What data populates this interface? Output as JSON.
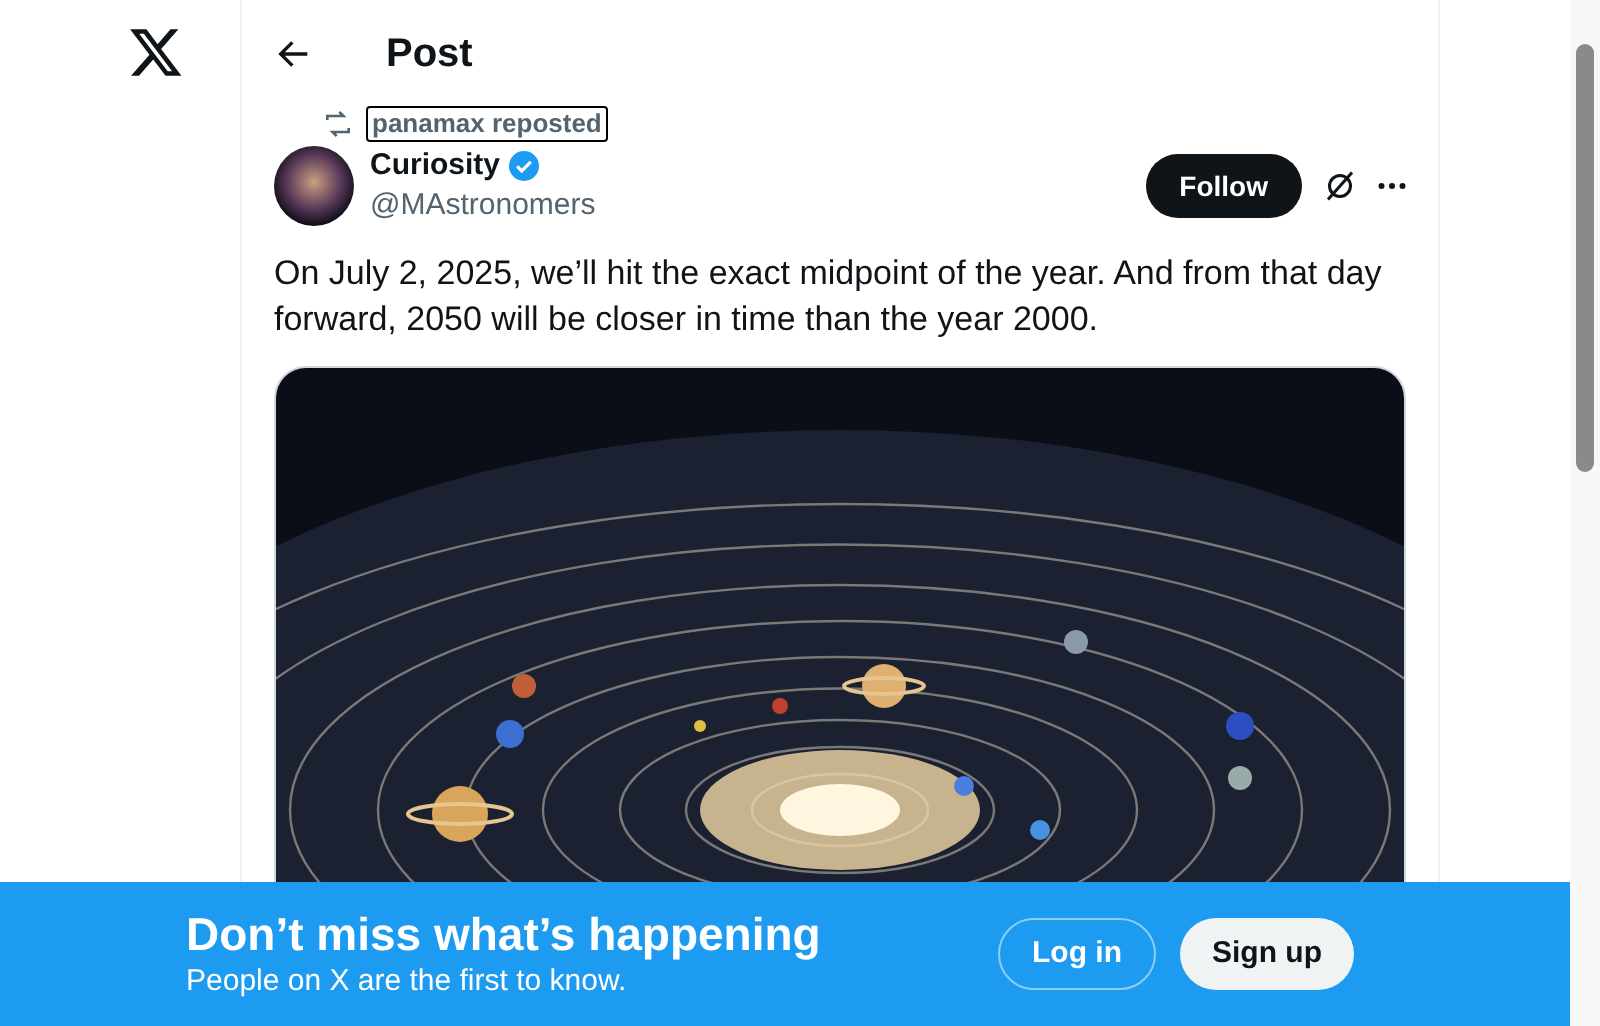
{
  "header": {
    "title": "Post"
  },
  "repost": {
    "text": "panamax reposted"
  },
  "author": {
    "name": "Curiosity",
    "handle": "@MAstronomers",
    "verified": true
  },
  "follow_button": "Follow",
  "post": {
    "text": "On July 2, 2025, we’ll hit the exact midpoint of the year. And from that day forward, 2050 will be closer in time than the year 2000."
  },
  "banner": {
    "title": "Don’t miss what’s happening",
    "subtitle": "People on X are the first to know.",
    "buttons": [
      {
        "label": "Log in",
        "kind": "outline"
      },
      {
        "label": "Sign up",
        "kind": "filled"
      }
    ]
  }
}
